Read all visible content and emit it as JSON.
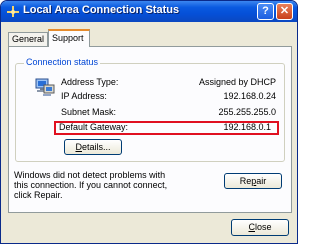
{
  "window": {
    "title": "Local Area Connection Status",
    "help_symbol": "?",
    "close_symbol": "✕",
    "title_icon": "network-connection-icon"
  },
  "tabs": [
    {
      "label": "General",
      "selected": false
    },
    {
      "label": "Support",
      "selected": true
    }
  ],
  "connection_status": {
    "group_label": "Connection status",
    "icon": "network-adapter-icon",
    "rows": [
      {
        "label": "Address Type:",
        "value": "Assigned by DHCP"
      },
      {
        "label": "IP Address:",
        "value": "192.168.0.24"
      },
      {
        "label": "Subnet Mask:",
        "value": "255.255.255.0"
      },
      {
        "label": "Default Gateway:",
        "value": "192.168.0.1"
      }
    ],
    "highlight_color": "#e01020",
    "details_button": {
      "mnemonic": "D",
      "rest": "etails..."
    }
  },
  "message": "Windows did not detect problems with this connection. If you cannot connect, click Repair.",
  "repair_button": {
    "before": "Re",
    "mnemonic": "p",
    "after": "air"
  },
  "close_button": {
    "mnemonic": "C",
    "rest": "lose"
  }
}
